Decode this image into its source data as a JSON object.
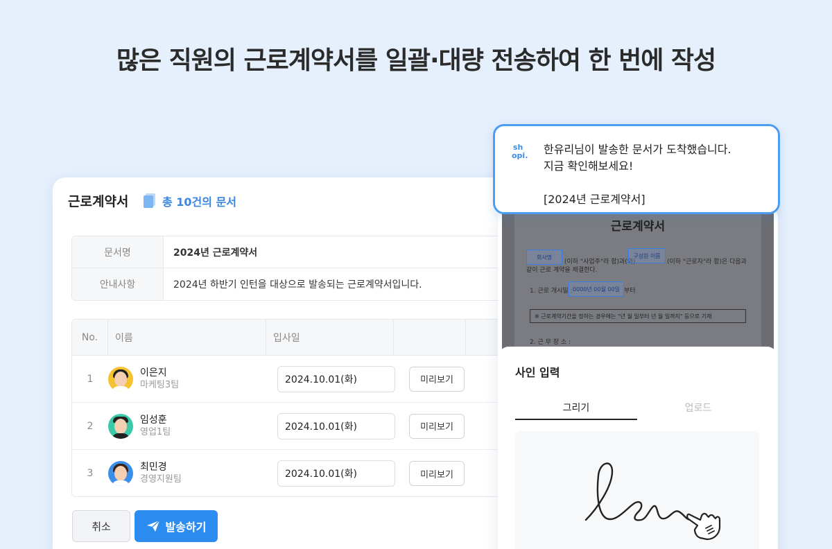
{
  "headline": "많은 직원의 근로계약서를 일괄·대량 전송하여 한 번에 작성",
  "card": {
    "title": "근로계약서",
    "doc_count": "총 10건의 문서",
    "info": [
      {
        "label": "문서명",
        "value": "2024년 근로계약서"
      },
      {
        "label": "안내사항",
        "value": "2024년 하반기 인턴을 대상으로 발송되는 근로계약서입니다."
      }
    ],
    "table_headers": {
      "no": "No.",
      "name": "이름",
      "date": "입사일"
    },
    "employees": [
      {
        "no": "1",
        "name": "이은지",
        "team": "마케팅3팀",
        "date": "2024.10.01(화)",
        "preview": "미리보기",
        "bg": "#f5c230"
      },
      {
        "no": "2",
        "name": "임성훈",
        "team": "영업1팀",
        "date": "2024.10.01(화)",
        "preview": "미리보기",
        "bg": "#3cc9a8"
      },
      {
        "no": "3",
        "name": "최민경",
        "team": "경영지원팀",
        "date": "2024.10.01(화)",
        "preview": "미리보기",
        "bg": "#3b8fe8"
      }
    ],
    "cancel_label": "취소",
    "send_label": "발송하기"
  },
  "phone": {
    "doc_title": "근로계약서",
    "field_company": "회사명",
    "field_member": "구성원 이름",
    "line1_a": "(이하 \"사업주\"라 함)과(와)",
    "line1_b": "(이하 \"근로자\"라 함)은 다음과",
    "line2": "같이 근로 계약을 체결한다.",
    "line3_a": "1. 근로 개시일 :",
    "field_date": "0000년 00월 00일",
    "line3_b": "부터",
    "box_note": "※ 근로계약기간을 정하는 경우에는 \"년 월 일부터 년 월 일까지\" 등으로 기재",
    "line4": "2. 근 무 장 소 :",
    "sign_title": "사인 입력",
    "tab_draw": "그리기",
    "tab_upload": "업로드"
  },
  "notification": {
    "logo": "sh opi.",
    "line1": "한유리님이 발송한 문서가 도착했습니다.",
    "line2": "지금 확인해보세요!",
    "doc": "[2024년 근로계약서]"
  }
}
